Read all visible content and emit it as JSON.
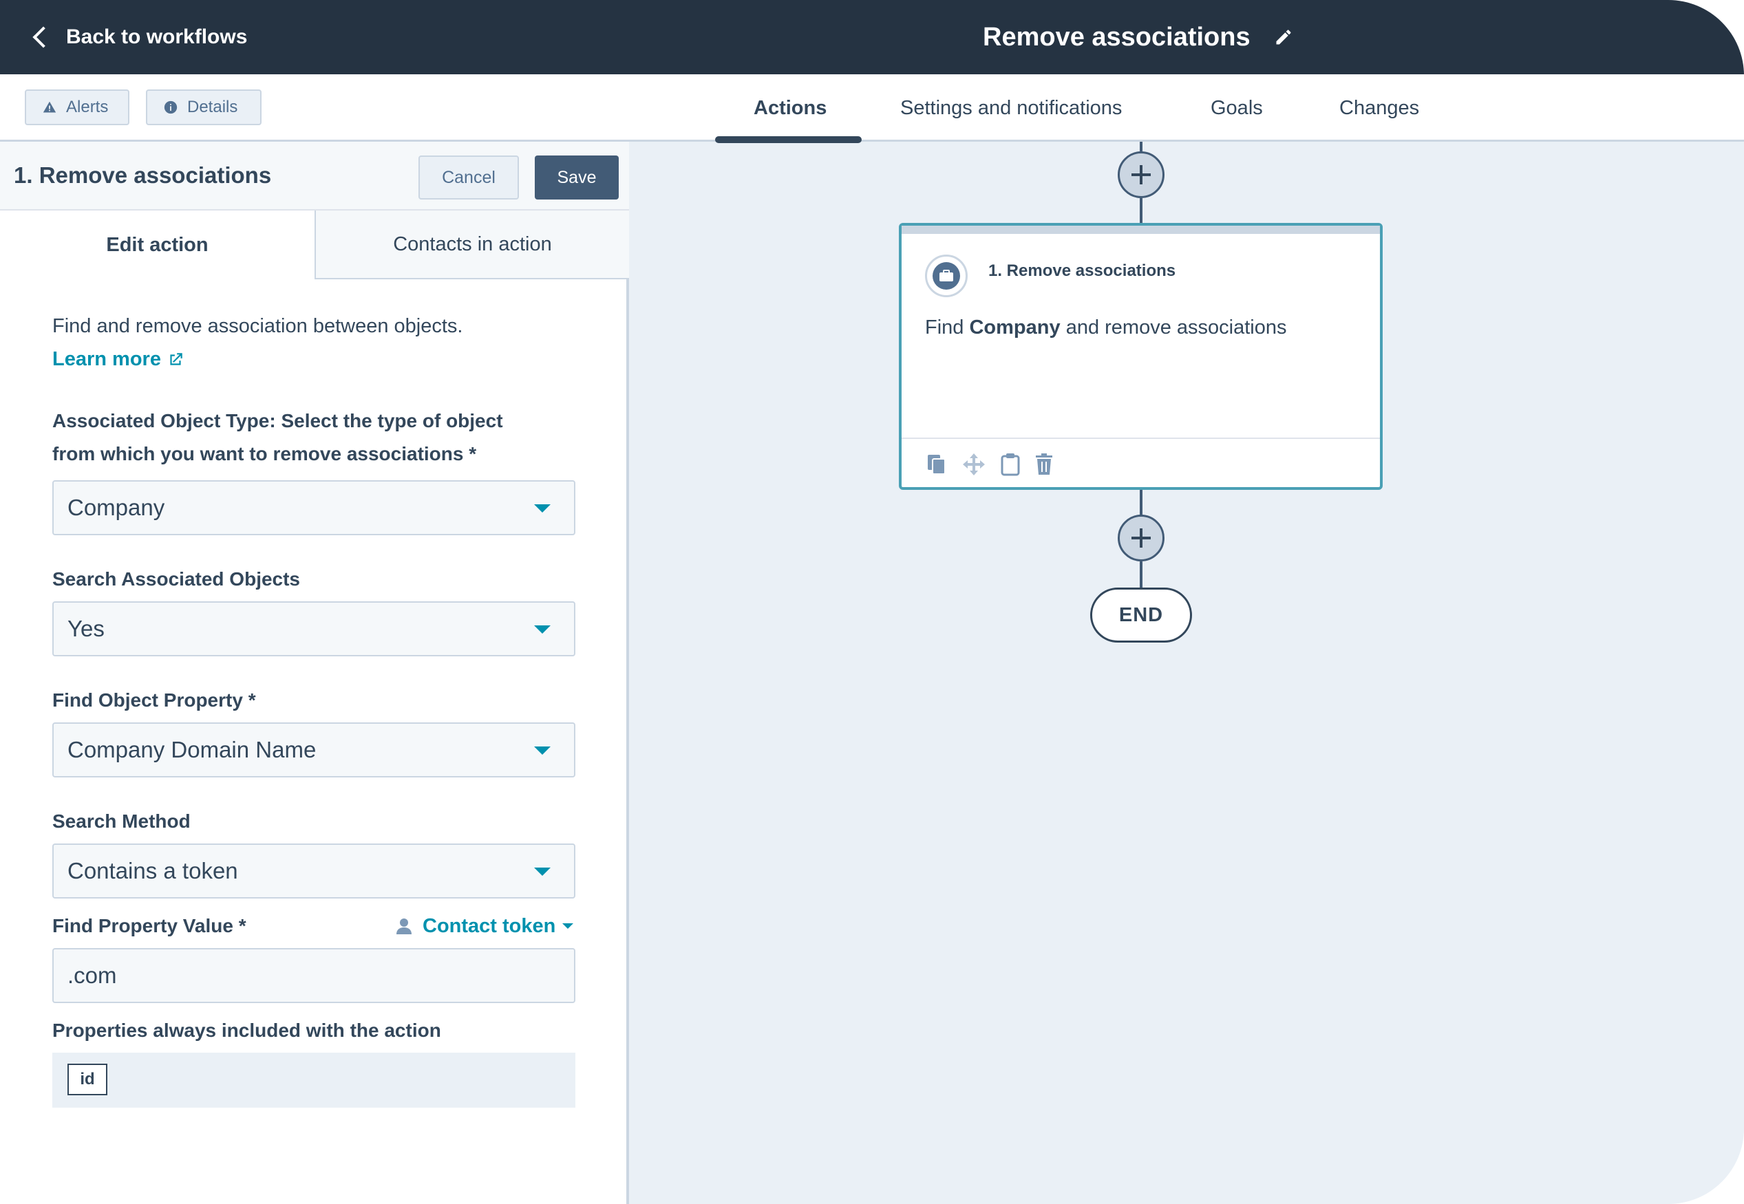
{
  "header": {
    "back_label": "Back to workflows",
    "title": "Remove associations"
  },
  "toolbar": {
    "alerts_label": "Alerts",
    "details_label": "Details"
  },
  "tabs": [
    {
      "label": "Actions",
      "active": true
    },
    {
      "label": "Settings and notifications",
      "active": false
    },
    {
      "label": "Goals",
      "active": false
    },
    {
      "label": "Changes",
      "active": false
    }
  ],
  "panel": {
    "title": "1. Remove associations",
    "cancel_label": "Cancel",
    "save_label": "Save",
    "tab_edit": "Edit action",
    "tab_contacts": "Contacts in action",
    "description": "Find and remove association between objects.",
    "learn_more": "Learn more",
    "fields": {
      "object_type": {
        "label_line1": "Associated Object Type: Select the type of object",
        "label_line2": "from which you want to remove associations *",
        "value": "Company"
      },
      "search_associated": {
        "label": "Search Associated Objects",
        "value": "Yes"
      },
      "find_property": {
        "label": "Find Object Property *",
        "value": "Company Domain Name"
      },
      "search_method": {
        "label": "Search Method",
        "value": "Contains a token"
      },
      "property_value": {
        "label": "Find Property Value *",
        "token_label": "Contact token",
        "value": ".com"
      },
      "properties_included": {
        "label": "Properties always included with the action",
        "tag": "id"
      }
    }
  },
  "canvas": {
    "card": {
      "title": "1. Remove associations",
      "desc_prefix": "Find",
      "desc_bold": "Company",
      "desc_suffix": "and remove associations"
    },
    "end_label": "END"
  },
  "colors": {
    "header_bg": "#253342",
    "accent": "#0091ae",
    "canvas_bg": "#eaf0f6",
    "card_border": "#4aa0b5",
    "save_bg": "#425b76"
  }
}
